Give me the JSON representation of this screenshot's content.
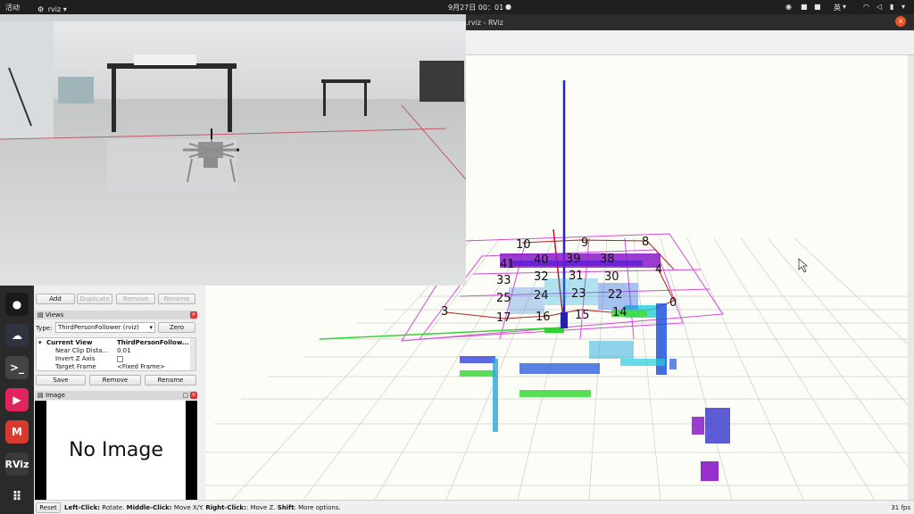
{
  "topbar": {
    "activities": "活动",
    "app_name": "rviz",
    "datetime": "9月27日  00：01",
    "lang": "英"
  },
  "window": {
    "title": ".rviz - RViz"
  },
  "displays_panel": {
    "buttons": [
      "Add",
      "Duplicate",
      "Remove",
      "Rename"
    ]
  },
  "views": {
    "title": "Views",
    "type_label": "Type:",
    "type_value": "ThirdPersonFollower (rviz)",
    "zero_label": "Zero",
    "tree": [
      {
        "key": "Current View",
        "value": "ThirdPersonFollow..."
      },
      {
        "key": "Near Clip Dista...",
        "value": "0.01"
      },
      {
        "key": "Invert Z Axis",
        "value": ""
      },
      {
        "key": "Target Frame",
        "value": "<Fixed Frame>"
      }
    ],
    "buttons": [
      "Save",
      "Remove",
      "Rename"
    ]
  },
  "image_panel": {
    "title": "Image",
    "content": "No Image"
  },
  "statusbar": {
    "reset": "Reset",
    "left_key": "Left-Click:",
    "left_val": " Rotate. ",
    "middle_key": "Middle-Click:",
    "middle_val": " Move X/Y. ",
    "right_key": "Right-Click:",
    "right_val": ": Move Z. ",
    "shift_key": "Shift",
    "shift_val": ": More options.",
    "fps": "31 fps"
  },
  "dock": [
    {
      "icon": "penguin-icon",
      "color": "#1a1a1a"
    },
    {
      "icon": "chat-icon",
      "color": "#2f3340"
    },
    {
      "icon": "terminal-icon",
      "color": "#444"
    },
    {
      "icon": "player-icon",
      "color": "#e0245e"
    },
    {
      "icon": "mindmap-icon",
      "color": "#d73a2f"
    },
    {
      "icon": "rviz-icon",
      "color": "#3a3a3a",
      "label": "RViz"
    },
    {
      "icon": "apps-grid-icon",
      "color": "#2a2a2a"
    }
  ],
  "scene": {
    "waypoints": [
      "10",
      "9",
      "8",
      "40",
      "39",
      "38",
      "41",
      "4",
      "33",
      "32",
      "31",
      "30",
      "25",
      "24",
      "23",
      "22",
      "0",
      "3",
      "17",
      "16",
      "15",
      "14"
    ]
  }
}
